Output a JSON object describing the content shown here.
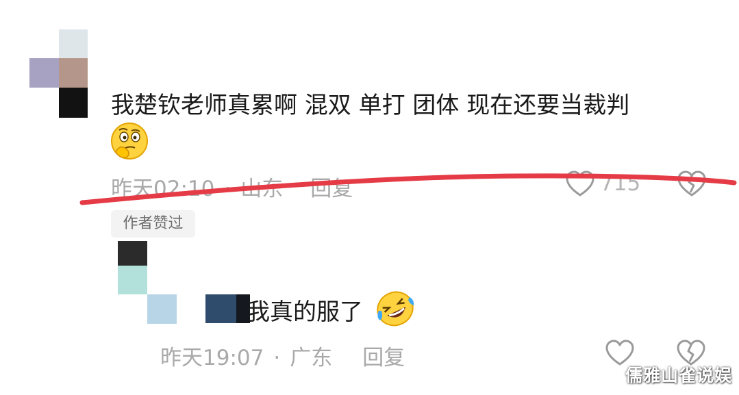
{
  "comment": {
    "text": "我楚钦老师真累啊  混双 单打 团体 现在还要当裁判",
    "emoji_icon": "thinking-face-emoji",
    "time": "昨天02:10",
    "location": "山东",
    "reply_label": "回复",
    "like_count": "715",
    "author_liked_tag": "作者赞过"
  },
  "reply": {
    "text": "我真的服了",
    "emoji_icon": "rolling-on-floor-laughing-emoji",
    "time": "昨天19:07",
    "location": "广东",
    "reply_label": "回复"
  },
  "separator": "·",
  "watermark": "儒雅山雀说娱",
  "colors": {
    "text": "#1a1a1a",
    "meta": "#a9a9a9",
    "red_marker": "#e53b46",
    "tag_bg": "#f3f3f3"
  }
}
